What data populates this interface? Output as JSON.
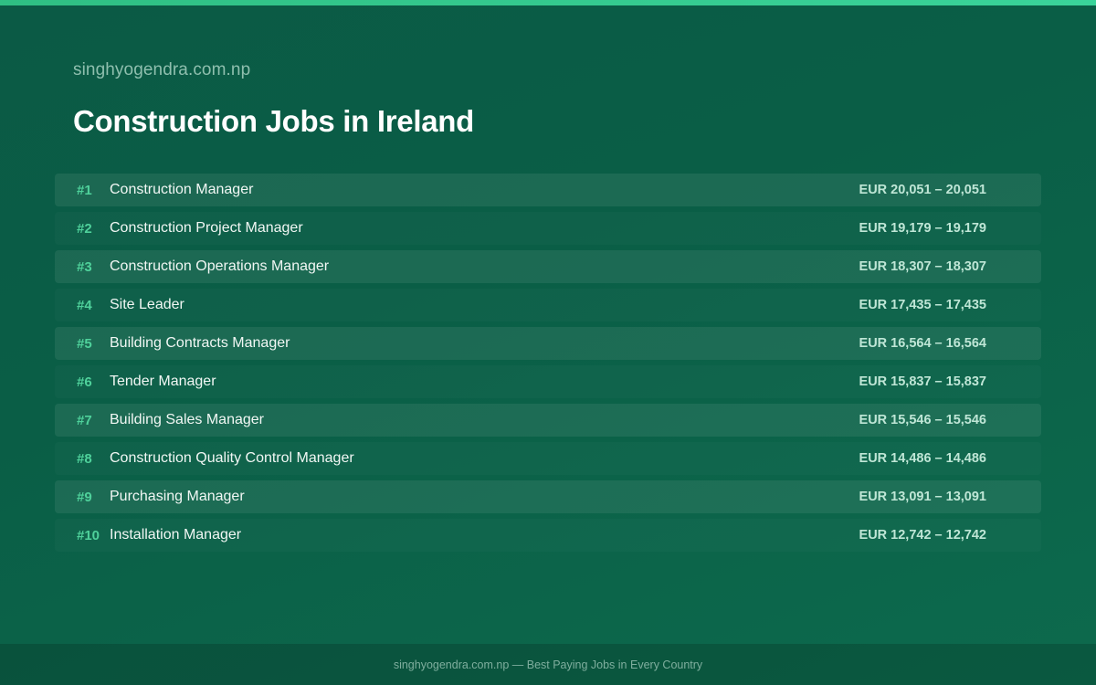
{
  "site_name": "singhyogendra.com.np",
  "title": "Construction Jobs in Ireland",
  "jobs": [
    {
      "rank": "#1",
      "title": "Construction Manager",
      "salary": "EUR 20,051 – 20,051"
    },
    {
      "rank": "#2",
      "title": "Construction Project Manager",
      "salary": "EUR 19,179 – 19,179"
    },
    {
      "rank": "#3",
      "title": "Construction Operations Manager",
      "salary": "EUR 18,307 – 18,307"
    },
    {
      "rank": "#4",
      "title": "Site Leader",
      "salary": "EUR 17,435 – 17,435"
    },
    {
      "rank": "#5",
      "title": "Building Contracts Manager",
      "salary": "EUR 16,564 – 16,564"
    },
    {
      "rank": "#6",
      "title": "Tender Manager",
      "salary": "EUR 15,837 – 15,837"
    },
    {
      "rank": "#7",
      "title": "Building Sales Manager",
      "salary": "EUR 15,546 – 15,546"
    },
    {
      "rank": "#8",
      "title": "Construction Quality Control Manager",
      "salary": "EUR 14,486 – 14,486"
    },
    {
      "rank": "#9",
      "title": "Purchasing Manager",
      "salary": "EUR 13,091 – 13,091"
    },
    {
      "rank": "#10",
      "title": "Installation Manager",
      "salary": "EUR 12,742 – 12,742"
    }
  ],
  "footer": "singhyogendra.com.np — Best Paying Jobs in Every Country",
  "colors": {
    "background": "#0b5a45",
    "accent": "#4fd19b",
    "top_bar": "#2fbf83"
  }
}
